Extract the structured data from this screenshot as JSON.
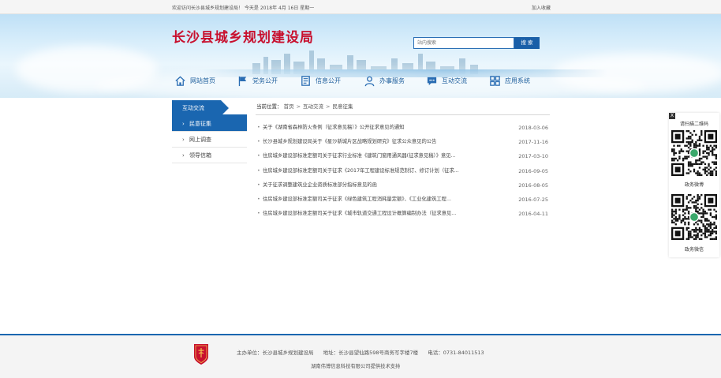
{
  "topbar": {
    "welcome": "欢迎访问长沙县城乡规划建设局！ 今天是 2018年 4月 16日 星期一",
    "favorite": "加入收藏"
  },
  "header": {
    "title": "长沙县城乡规划建设局",
    "search_placeholder": "站内搜索",
    "search_button": "搜 索"
  },
  "nav": [
    {
      "label": "网站首页",
      "icon": "home-icon"
    },
    {
      "label": "党务公开",
      "icon": "flag-icon"
    },
    {
      "label": "信息公开",
      "icon": "document-icon"
    },
    {
      "label": "办事服务",
      "icon": "person-icon"
    },
    {
      "label": "互动交流",
      "icon": "chat-icon"
    },
    {
      "label": "应用系统",
      "icon": "grid-icon"
    }
  ],
  "sidebar": {
    "heading": "互动交流",
    "items": [
      {
        "label": "民意征集",
        "active": true
      },
      {
        "label": "网上调查",
        "active": false
      },
      {
        "label": "领导信箱",
        "active": false
      }
    ]
  },
  "breadcrumb": {
    "prefix": "当前位置：",
    "items": [
      "首页",
      "互动交流",
      "民意征集"
    ]
  },
  "news": [
    {
      "title": "关于《湖南省森林防火条例（征求意见稿）》公开征求意见的通知",
      "date": "2018-03-06"
    },
    {
      "title": "长沙县城乡规划建设局关于《星沙新城片区战略规划研究》征求公众意见的公告",
      "date": "2017-11-16"
    },
    {
      "title": "住房城乡建设部标准定额司关于征求行业标准《建筑门窗用通风器(征求意见稿）》意见...",
      "date": "2017-03-10"
    },
    {
      "title": "住房城乡建设部标准定额司关于征求《2017年工程建设标准规范制订、修订计划（征求...",
      "date": "2016-09-05"
    },
    {
      "title": "关于征求调整建筑业企业资质标准部分指标意见的函",
      "date": "2016-08-05"
    },
    {
      "title": "住房城乡建设部标准定额司关于征求《绿色建筑工程消耗量定额》、《工业化建筑工程...",
      "date": "2016-07-25"
    },
    {
      "title": "住房城乡建设部标准定额司关于征求《城市轨道交通工程设计概算编制办法（征求意见...",
      "date": "2016-04-11"
    }
  ],
  "qr": {
    "close": "X",
    "title": "请扫描二维码",
    "codes": [
      {
        "caption": "政务微博"
      },
      {
        "caption": "政务微信"
      }
    ]
  },
  "footer": {
    "host": "主办单位：长沙县城乡规划建设局",
    "address": "地址：长沙县望仙路598号商务写字楼7楼",
    "phone": "电话：0731-84011513",
    "support": "湖南伟博信息科技有限公司提供技术支持"
  },
  "colors": {
    "brand_blue": "#1a66b0",
    "title_red": "#c8102e",
    "nav_text": "#1b5d9c"
  }
}
